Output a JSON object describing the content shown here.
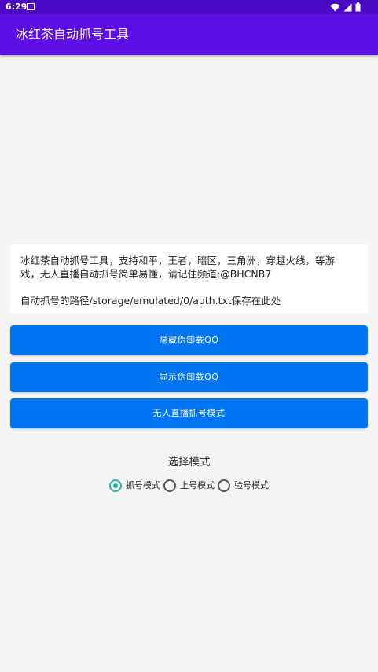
{
  "status_bar": {
    "time": "6:29",
    "icons": [
      "notification-icon",
      "wifi-icon",
      "signal-icon",
      "battery-icon"
    ]
  },
  "app_bar": {
    "title": "冰红茶自动抓号工具",
    "color": "#5d0fe6"
  },
  "info": {
    "line1": "冰红茶自动抓号工具，支持和平，王者，暗区，三角洲，穿越火线，等游",
    "line2": "戏，无人直播自动抓号简单易懂，请记住频道:@BHCNB7",
    "line3": "自动抓号的路径/storage/emulated/0/auth.txt保存在此处"
  },
  "buttons": {
    "hide_label": "隐藏伪卸载QQ",
    "show_label": "显示伪卸载QQ",
    "live_label": "无人直播抓号模式",
    "color": "#0075f2"
  },
  "mode": {
    "label": "选择模式",
    "options": [
      "抓号模式",
      "上号模式",
      "验号模式"
    ],
    "selected": "抓号模式",
    "accent": "#26b8a9"
  }
}
